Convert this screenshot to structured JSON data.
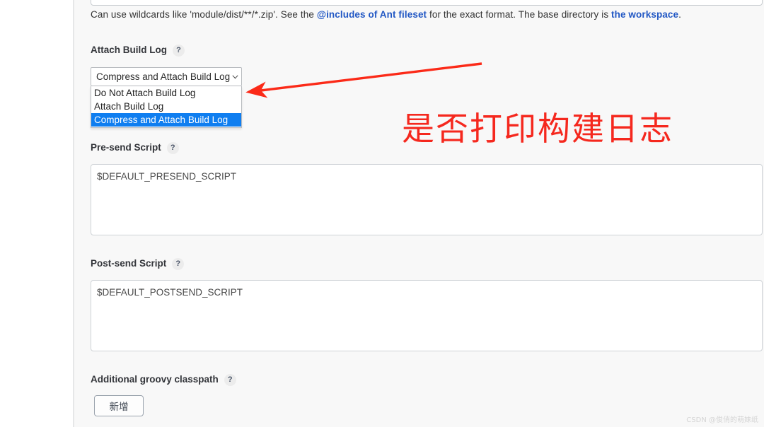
{
  "colors": {
    "panel_background": "#f8f8f8",
    "page_background": "#ffffff",
    "link": "#2157c4",
    "option_highlight": "#0f7ef0",
    "annotation_red": "#f5281e",
    "label_text": "#33353a",
    "watermark": "#d5d5d5"
  },
  "help_text": {
    "part1": "Can use wildcards like 'module/dist/**/*.zip'. See the ",
    "link1": "@includes of Ant fileset",
    "part2": " for the exact format. The base directory is ",
    "link2": "the workspace",
    "part3": "."
  },
  "fields": {
    "attach_build_log": {
      "label": "Attach Build Log",
      "help_icon": "?",
      "selected_value": "Compress and Attach Build Log",
      "chevron_icon": "chevron-down-icon",
      "options": [
        {
          "label": "Do Not Attach Build Log",
          "selected": false
        },
        {
          "label": "Attach Build Log",
          "selected": false
        },
        {
          "label": "Compress and Attach Build Log",
          "selected": true
        }
      ]
    },
    "pre_send_script": {
      "label": "Pre-send Script",
      "help_icon": "?",
      "value": "$DEFAULT_PRESEND_SCRIPT"
    },
    "post_send_script": {
      "label": "Post-send Script",
      "help_icon": "?",
      "value": "$DEFAULT_POSTSEND_SCRIPT"
    },
    "additional_groovy_classpath": {
      "label": "Additional groovy classpath",
      "help_icon": "?",
      "add_button_label": "新增"
    }
  },
  "annotation": {
    "text": "是否打印构建日志",
    "arrow": "red-arrow-pointing-left"
  },
  "watermark": {
    "text": "CSDN @俊俏的萌妹纸"
  }
}
